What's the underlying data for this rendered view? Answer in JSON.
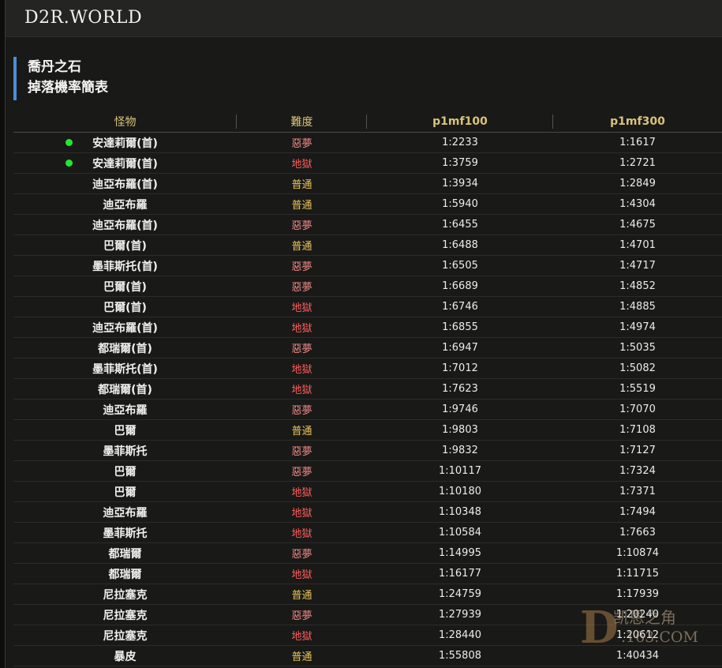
{
  "app": {
    "logo": "D2R.WORLD"
  },
  "heading": {
    "line1": "喬丹之石",
    "line2": "掉落機率簡表"
  },
  "table": {
    "columns": [
      "怪物",
      "難度",
      "p1mf100",
      "p1mf300"
    ],
    "rows": [
      {
        "monster": "安達莉爾(首)",
        "difficulty": "惡夢",
        "type": "nightmare",
        "mf100": "1:2233",
        "mf300": "1:1617",
        "dot": true
      },
      {
        "monster": "安達莉爾(首)",
        "difficulty": "地獄",
        "type": "hell",
        "mf100": "1:3759",
        "mf300": "1:2721",
        "dot": true
      },
      {
        "monster": "迪亞布羅(首)",
        "difficulty": "普通",
        "type": "normal",
        "mf100": "1:3934",
        "mf300": "1:2849",
        "dot": false
      },
      {
        "monster": "迪亞布羅",
        "difficulty": "普通",
        "type": "normal",
        "mf100": "1:5940",
        "mf300": "1:4304",
        "dot": false
      },
      {
        "monster": "迪亞布羅(首)",
        "difficulty": "惡夢",
        "type": "nightmare",
        "mf100": "1:6455",
        "mf300": "1:4675",
        "dot": false
      },
      {
        "monster": "巴爾(首)",
        "difficulty": "普通",
        "type": "normal",
        "mf100": "1:6488",
        "mf300": "1:4701",
        "dot": false
      },
      {
        "monster": "墨菲斯托(首)",
        "difficulty": "惡夢",
        "type": "nightmare",
        "mf100": "1:6505",
        "mf300": "1:4717",
        "dot": false
      },
      {
        "monster": "巴爾(首)",
        "difficulty": "惡夢",
        "type": "nightmare",
        "mf100": "1:6689",
        "mf300": "1:4852",
        "dot": false
      },
      {
        "monster": "巴爾(首)",
        "difficulty": "地獄",
        "type": "hell",
        "mf100": "1:6746",
        "mf300": "1:4885",
        "dot": false
      },
      {
        "monster": "迪亞布羅(首)",
        "difficulty": "地獄",
        "type": "hell",
        "mf100": "1:6855",
        "mf300": "1:4974",
        "dot": false
      },
      {
        "monster": "都瑞爾(首)",
        "difficulty": "惡夢",
        "type": "nightmare",
        "mf100": "1:6947",
        "mf300": "1:5035",
        "dot": false
      },
      {
        "monster": "墨菲斯托(首)",
        "difficulty": "地獄",
        "type": "hell",
        "mf100": "1:7012",
        "mf300": "1:5082",
        "dot": false
      },
      {
        "monster": "都瑞爾(首)",
        "difficulty": "地獄",
        "type": "hell",
        "mf100": "1:7623",
        "mf300": "1:5519",
        "dot": false
      },
      {
        "monster": "迪亞布羅",
        "difficulty": "惡夢",
        "type": "nightmare",
        "mf100": "1:9746",
        "mf300": "1:7070",
        "dot": false
      },
      {
        "monster": "巴爾",
        "difficulty": "普通",
        "type": "normal",
        "mf100": "1:9803",
        "mf300": "1:7108",
        "dot": false
      },
      {
        "monster": "墨菲斯托",
        "difficulty": "惡夢",
        "type": "nightmare",
        "mf100": "1:9832",
        "mf300": "1:7127",
        "dot": false
      },
      {
        "monster": "巴爾",
        "difficulty": "惡夢",
        "type": "nightmare",
        "mf100": "1:10117",
        "mf300": "1:7324",
        "dot": false
      },
      {
        "monster": "巴爾",
        "difficulty": "地獄",
        "type": "hell",
        "mf100": "1:10180",
        "mf300": "1:7371",
        "dot": false
      },
      {
        "monster": "迪亞布羅",
        "difficulty": "地獄",
        "type": "hell",
        "mf100": "1:10348",
        "mf300": "1:7494",
        "dot": false
      },
      {
        "monster": "墨菲斯托",
        "difficulty": "地獄",
        "type": "hell",
        "mf100": "1:10584",
        "mf300": "1:7663",
        "dot": false
      },
      {
        "monster": "都瑞爾",
        "difficulty": "惡夢",
        "type": "nightmare",
        "mf100": "1:14995",
        "mf300": "1:10874",
        "dot": false
      },
      {
        "monster": "都瑞爾",
        "difficulty": "地獄",
        "type": "hell",
        "mf100": "1:16177",
        "mf300": "1:11715",
        "dot": false
      },
      {
        "monster": "尼拉塞克",
        "difficulty": "普通",
        "type": "normal",
        "mf100": "1:24759",
        "mf300": "1:17939",
        "dot": false
      },
      {
        "monster": "尼拉塞克",
        "difficulty": "惡夢",
        "type": "nightmare",
        "mf100": "1:27939",
        "mf300": "1:20240",
        "dot": false
      },
      {
        "monster": "尼拉塞克",
        "difficulty": "地獄",
        "type": "hell",
        "mf100": "1:28440",
        "mf300": "1:20612",
        "dot": false
      },
      {
        "monster": "暴皮",
        "difficulty": "普通",
        "type": "normal",
        "mf100": "1:55808",
        "mf300": "1:40434",
        "dot": false
      }
    ]
  },
  "watermark": {
    "letter": "D",
    "line1": "凯恩之角",
    "line2": ".163.COM"
  },
  "colors": {
    "accent": "#4a8fd6",
    "header_text": "#d9c37a",
    "normal": "#e7c45a",
    "nightmare": "#ee8a8a",
    "hell": "#ff5f5f",
    "dot": "#22e82c"
  }
}
